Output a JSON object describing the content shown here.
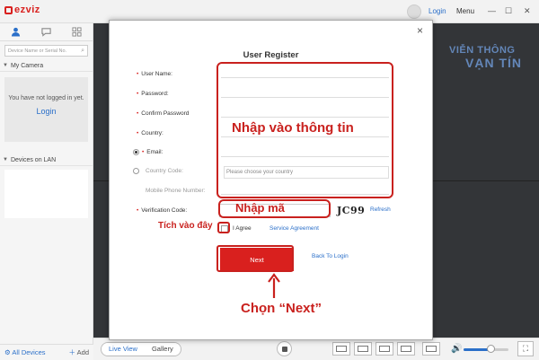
{
  "app": {
    "brand": "ezviz"
  },
  "topbar": {
    "login_label": "Login",
    "menu_label": "Menu"
  },
  "sidebar": {
    "search_placeholder": "Device Name or Serial No.",
    "my_camera_label": "My Camera",
    "not_logged_text": "You have not logged in yet.",
    "login_link": "Login",
    "devices_lan_label": "Devices on LAN",
    "all_devices_label": "All Devices",
    "add_label": "Add"
  },
  "bottombar": {
    "live_view_label": "Live View",
    "gallery_label": "Gallery",
    "volume_level": 0.6
  },
  "watermark": {
    "line1": "VIỄN THÔNG",
    "line2": "VẠN TÍN"
  },
  "dialog": {
    "title": "User Register",
    "close_glyph": "×",
    "fields": {
      "username_label": "User Name:",
      "password_label": "Password:",
      "confirm_password_label": "Confirm Password",
      "country_label": "Country:",
      "email_label": "Email:",
      "country_code_label": "Country Code:",
      "country_placeholder": "Please choose your country",
      "mobile_label": "Mobile Phone Number:",
      "verification_label": "Verification Code:",
      "captcha_text": "JC99",
      "refresh_label": "Refresh",
      "agree_label": "I Agree",
      "service_agreement_label": "Service Agreement"
    },
    "next_label": "Next",
    "back_to_login_label": "Back To Login"
  },
  "annotations": {
    "enter_info": "Nhập vào thông tin",
    "enter_code": "Nhập mã",
    "tick_here": "Tích vào đây",
    "choose_next": "Chọn “Next”"
  },
  "colors": {
    "brand_red": "#d9201e",
    "link_blue": "#2a6fc9",
    "annotation_red": "#c9211e",
    "video_bg": "#333538"
  }
}
